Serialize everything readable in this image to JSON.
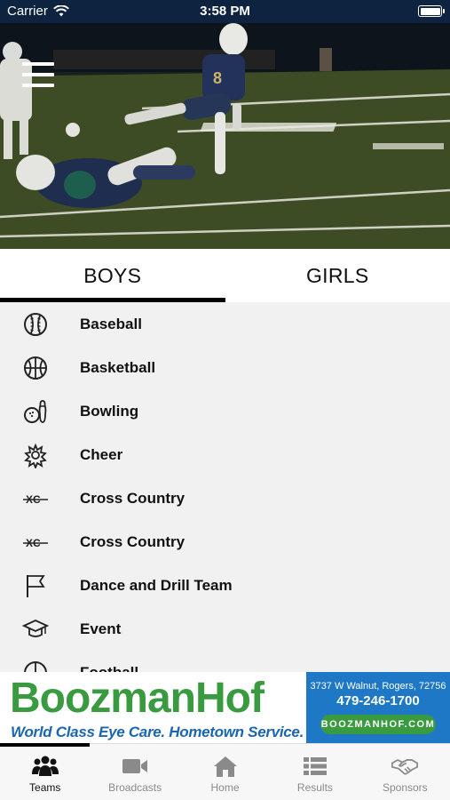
{
  "status_bar": {
    "carrier": "Carrier",
    "time": "3:58 PM"
  },
  "tabs": [
    {
      "label": "BOYS",
      "selected": true
    },
    {
      "label": "GIRLS",
      "selected": false
    }
  ],
  "sports": [
    {
      "label": "Baseball",
      "icon": "baseball-icon"
    },
    {
      "label": "Basketball",
      "icon": "basketball-icon"
    },
    {
      "label": "Bowling",
      "icon": "bowling-icon"
    },
    {
      "label": "Cheer",
      "icon": "pom-pom-icon"
    },
    {
      "label": "Cross Country",
      "icon": "xc-icon"
    },
    {
      "label": "Cross Country",
      "icon": "xc-icon"
    },
    {
      "label": "Dance and Drill Team",
      "icon": "flag-icon"
    },
    {
      "label": "Event",
      "icon": "graduation-cap-icon"
    },
    {
      "label": "Football",
      "icon": "football-icon"
    }
  ],
  "ad": {
    "brand": "BoozmanHof",
    "tagline": "World Class Eye Care. Hometown Service.",
    "address": "3737 W Walnut, Rogers, 72756",
    "phone": "479-246-1700",
    "url": "BOOZMANHOF.COM",
    "brand_color": "#3a9a40",
    "accent_color": "#1e78c6"
  },
  "tab_bar": [
    {
      "label": "Teams",
      "icon": "team-icon",
      "active": true
    },
    {
      "label": "Broadcasts",
      "icon": "video-camera-icon",
      "active": false
    },
    {
      "label": "Home",
      "icon": "home-icon",
      "active": false
    },
    {
      "label": "Results",
      "icon": "list-icon",
      "active": false
    },
    {
      "label": "Sponsors",
      "icon": "handshake-icon",
      "active": false
    }
  ]
}
